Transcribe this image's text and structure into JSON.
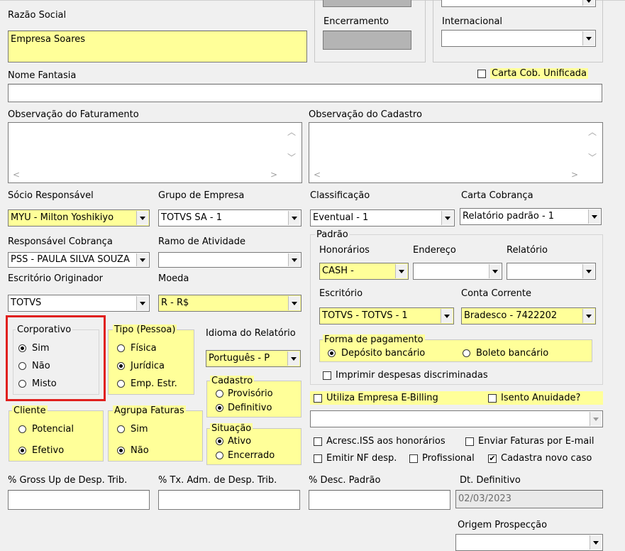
{
  "labels": {
    "razao_social": "Razão Social",
    "encerramento": "Encerramento",
    "internacional": "Internacional",
    "nome_fantasia": "Nome Fantasia",
    "carta_cob_unificada": "Carta Cob. Unificada",
    "obs_faturamento": "Observação do Faturamento",
    "obs_cadastro": "Observação do Cadastro",
    "socio_responsavel": "Sócio Responsável",
    "grupo_empresa": "Grupo de Empresa",
    "classificacao": "Classificação",
    "carta_cobranca": "Carta Cobrança",
    "responsavel_cobranca": "Responsável Cobrança",
    "ramo_atividade": "Ramo de Atividade",
    "escritorio_originador": "Escritório Originador",
    "moeda": "Moeda",
    "idioma_relatorio": "Idioma do Relatório",
    "gross_up": "% Gross Up de Desp. Trib.",
    "tx_adm": "% Tx. Adm. de Desp. Trib.",
    "desc_padrao": "% Desc. Padrão",
    "dt_definitivo": "Dt. Definitivo",
    "origem_prospeccao": "Origem Prospecção"
  },
  "values": {
    "razao_social": "Empresa Soares",
    "nome_fantasia": "",
    "socio_responsavel": "MYU - Milton Yoshikiyo",
    "grupo_empresa": "TOTVS SA - 1",
    "classificacao": "Eventual - 1",
    "carta_cobranca": "Relatório padrão - 1",
    "responsavel_cobranca": "PSS - PAULA SILVA SOUZA",
    "ramo_atividade": "",
    "escritorio_originador": "TOTVS",
    "moeda": "R - R$",
    "idioma_relatorio": "Português - P",
    "dt_definitivo": "02/03/2023",
    "internacional": "",
    "origem_prospeccao": ""
  },
  "padrao": {
    "title": "Padrão",
    "honorarios_label": "Honorários",
    "endereco_label": "Endereço",
    "relatorio_label": "Relatório",
    "honorarios_value": "CASH -",
    "endereco_value": "",
    "relatorio_value": "",
    "escritorio_label": "Escritório",
    "conta_corrente_label": "Conta Corrente",
    "escritorio_value": "TOTVS - TOTVS - 1",
    "conta_corrente_value": "Bradesco - 7422202",
    "forma_pagamento_title": "Forma de pagamento",
    "deposito": "Depósito bancário",
    "boleto": "Boleto bancário",
    "imprimir_despesas": "Imprimir despesas discriminadas"
  },
  "corporativo": {
    "title": "Corporativo",
    "options": [
      "Sim",
      "Não",
      "Misto"
    ],
    "selected": "Sim"
  },
  "tipo_pessoa": {
    "title": "Tipo (Pessoa)",
    "options": [
      "Física",
      "Jurídica",
      "Emp. Estr."
    ],
    "selected": "Jurídica"
  },
  "cliente": {
    "title": "Cliente",
    "options": [
      "Potencial",
      "Efetivo"
    ],
    "selected": "Efetivo"
  },
  "agrupa_faturas": {
    "title": "Agrupa Faturas",
    "options": [
      "Sim",
      "Não"
    ],
    "selected": "Não"
  },
  "cadastro": {
    "title": "Cadastro",
    "options": [
      "Provisório",
      "Definitivo"
    ],
    "selected": "Definitivo"
  },
  "situacao": {
    "title": "Situação",
    "options": [
      "Ativo",
      "Encerrado"
    ],
    "selected": "Ativo"
  },
  "checks": {
    "utiliza_ebilling": "Utiliza Empresa E-Billing",
    "isento_anuidade": "Isento Anuidade?",
    "acresc_iss": "Acresc.ISS aos honorários",
    "enviar_faturas": "Enviar Faturas por E-mail",
    "emitir_nf": "Emitir NF desp.",
    "profissional": "Profissional",
    "cadastra_novo_caso": "Cadastra novo caso",
    "cadastra_novo_caso_checked": true
  },
  "colors": {
    "highlight": "#ffff99",
    "selection_box": "#e0201e",
    "background": "#f0f0f0"
  }
}
